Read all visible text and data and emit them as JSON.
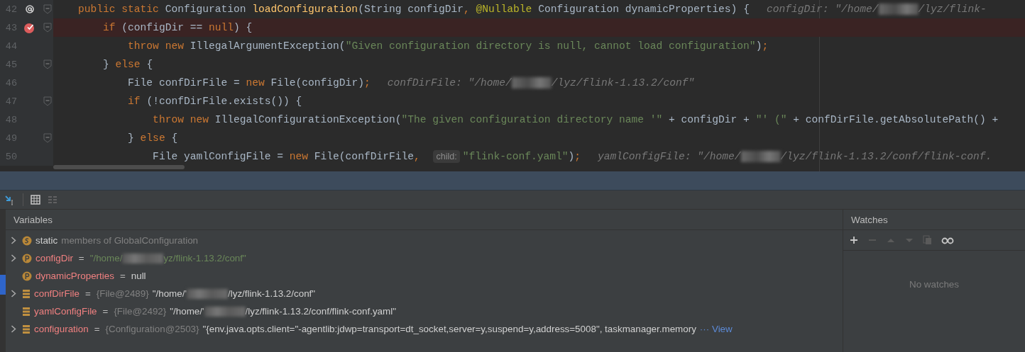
{
  "editor": {
    "lines": [
      {
        "number": "42",
        "kind": "annotated",
        "fold": true,
        "highlighted": false,
        "tokens": [
          {
            "kind": "kw",
            "text": "    public static "
          },
          {
            "kind": "plain",
            "text": "Configuration "
          },
          {
            "kind": "decl",
            "text": "loadConfiguration"
          },
          {
            "kind": "plain",
            "text": "(String configDir"
          },
          {
            "kind": "kw",
            "text": ", "
          },
          {
            "kind": "ann",
            "text": "@Nullable"
          },
          {
            "kind": "plain",
            "text": " Configuration dynamicProperties) {"
          },
          {
            "kind": "hint",
            "text": "configDir: \"/home/"
          },
          {
            "kind": "redacted"
          },
          {
            "kind": "hint",
            "text": "/lyz/flink-"
          }
        ]
      },
      {
        "number": "43",
        "kind": "breakpoint",
        "fold": true,
        "highlighted": true,
        "tokens": [
          {
            "kind": "kw",
            "text": "        if "
          },
          {
            "kind": "plain",
            "text": "(configDir == "
          },
          {
            "kind": "kw",
            "text": "null"
          },
          {
            "kind": "plain",
            "text": ") {"
          }
        ]
      },
      {
        "number": "44",
        "kind": "plain",
        "fold": false,
        "highlighted": false,
        "tokens": [
          {
            "kind": "kw",
            "text": "            throw new "
          },
          {
            "kind": "plain",
            "text": "IllegalArgumentException("
          },
          {
            "kind": "str",
            "text": "\"Given configuration directory is null, cannot load configuration\""
          },
          {
            "kind": "plain",
            "text": ")"
          },
          {
            "kind": "kw",
            "text": ";"
          }
        ]
      },
      {
        "number": "45",
        "kind": "plain",
        "fold": true,
        "highlighted": false,
        "tokens": [
          {
            "kind": "plain",
            "text": "        } "
          },
          {
            "kind": "kw",
            "text": "else "
          },
          {
            "kind": "plain",
            "text": "{"
          }
        ]
      },
      {
        "number": "46",
        "kind": "plain",
        "fold": false,
        "highlighted": false,
        "tokens": [
          {
            "kind": "plain",
            "text": "            File confDirFile = "
          },
          {
            "kind": "kw",
            "text": "new "
          },
          {
            "kind": "plain",
            "text": "File(configDir)"
          },
          {
            "kind": "kw",
            "text": ";"
          },
          {
            "kind": "hint",
            "text": "confDirFile: \"/home/"
          },
          {
            "kind": "redacted"
          },
          {
            "kind": "hint",
            "text": "/lyz/flink-1.13.2/conf\""
          }
        ]
      },
      {
        "number": "47",
        "kind": "plain",
        "fold": true,
        "highlighted": false,
        "tokens": [
          {
            "kind": "kw",
            "text": "            if "
          },
          {
            "kind": "plain",
            "text": "(!confDirFile.exists()) {"
          }
        ]
      },
      {
        "number": "48",
        "kind": "plain",
        "fold": false,
        "highlighted": false,
        "tokens": [
          {
            "kind": "kw",
            "text": "                throw new "
          },
          {
            "kind": "plain",
            "text": "IllegalConfigurationException("
          },
          {
            "kind": "str",
            "text": "\"The given configuration directory name '\""
          },
          {
            "kind": "plain",
            "text": " + configDir + "
          },
          {
            "kind": "str",
            "text": "\"' (\""
          },
          {
            "kind": "plain",
            "text": " + confDirFile.getAbsolutePath() +"
          }
        ]
      },
      {
        "number": "49",
        "kind": "plain",
        "fold": true,
        "highlighted": false,
        "tokens": [
          {
            "kind": "plain",
            "text": "            } "
          },
          {
            "kind": "kw",
            "text": "else "
          },
          {
            "kind": "plain",
            "text": "{"
          }
        ]
      },
      {
        "number": "50",
        "kind": "plain",
        "fold": false,
        "highlighted": false,
        "tokens": [
          {
            "kind": "plain",
            "text": "                File yamlConfigFile = "
          },
          {
            "kind": "kw",
            "text": "new "
          },
          {
            "kind": "plain",
            "text": "File(confDirFile"
          },
          {
            "kind": "kw",
            "text": ", "
          },
          {
            "kind": "badge",
            "text": "child:"
          },
          {
            "kind": "str",
            "text": "\"flink-conf.yaml\""
          },
          {
            "kind": "plain",
            "text": ")"
          },
          {
            "kind": "kw",
            "text": ";"
          },
          {
            "kind": "hint",
            "text": "yamlConfigFile: \"/home/"
          },
          {
            "kind": "redacted"
          },
          {
            "kind": "hint",
            "text": "/lyz/flink-1.13.2/conf/flink-conf."
          }
        ]
      }
    ]
  },
  "variables": {
    "title": "Variables",
    "rows": [
      {
        "kind": "static",
        "expandable": true,
        "name": "static",
        "parts": [
          {
            "kind": "muted",
            "text": "members of GlobalConfiguration"
          }
        ]
      },
      {
        "kind": "param",
        "expandable": true,
        "name": "configDir",
        "separator": "=",
        "parts": [
          {
            "kind": "string",
            "text": "\"/home/"
          },
          {
            "kind": "redacted"
          },
          {
            "kind": "string",
            "text": "yz/flink-1.13.2/conf\""
          }
        ]
      },
      {
        "kind": "param",
        "expandable": false,
        "name": "dynamicProperties",
        "separator": "=",
        "parts": [
          {
            "kind": "text",
            "text": "null"
          }
        ]
      },
      {
        "kind": "field",
        "expandable": true,
        "name": "confDirFile",
        "separator": "=",
        "parts": [
          {
            "kind": "muted",
            "text": "{File@2489}"
          },
          {
            "kind": "text",
            "text": "\"/home/'"
          },
          {
            "kind": "redacted"
          },
          {
            "kind": "text",
            "text": "/lyz/flink-1.13.2/conf\""
          }
        ]
      },
      {
        "kind": "field",
        "expandable": false,
        "name": "yamlConfigFile",
        "separator": "=",
        "parts": [
          {
            "kind": "muted",
            "text": "{File@2492}"
          },
          {
            "kind": "text",
            "text": "\"/home/'"
          },
          {
            "kind": "redacted"
          },
          {
            "kind": "text",
            "text": "/lyz/flink-1.13.2/conf/flink-conf.yaml\""
          }
        ]
      },
      {
        "kind": "field",
        "expandable": true,
        "name": "configuration",
        "separator": "=",
        "parts": [
          {
            "kind": "muted",
            "text": "{Configuration@2503}"
          },
          {
            "kind": "text",
            "text": "\"{env.java.opts.client=\"-agentlib:jdwp=transport=dt_socket,server=y,suspend=y,address=5008\", taskmanager.memory"
          },
          {
            "kind": "link",
            "text": "··· View"
          }
        ]
      }
    ]
  },
  "watches": {
    "title": "Watches",
    "tools": [
      {
        "kind": "add",
        "disabled": false
      },
      {
        "kind": "remove",
        "disabled": true
      },
      {
        "kind": "up",
        "disabled": true
      },
      {
        "kind": "down",
        "disabled": true
      },
      {
        "kind": "copy",
        "disabled": true
      },
      {
        "kind": "glasses",
        "disabled": false
      }
    ],
    "empty_text": "No watches"
  }
}
